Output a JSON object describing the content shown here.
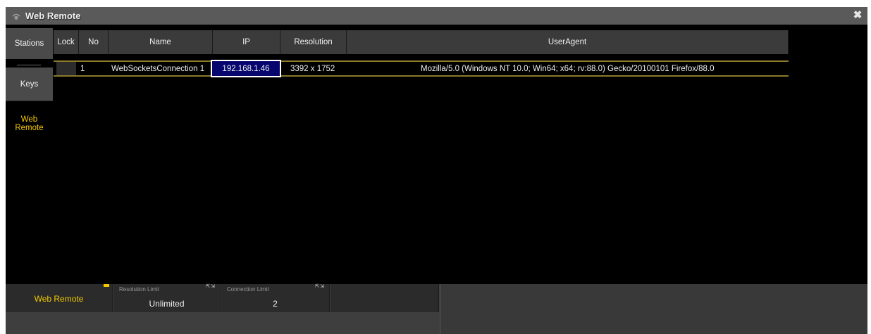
{
  "window": {
    "title": "Web Remote"
  },
  "sidebar": {
    "tabs": [
      {
        "label": "Stations"
      },
      {
        "label": "Keys"
      },
      {
        "label": "Web Remote"
      }
    ]
  },
  "table": {
    "headers": {
      "lock": "Lock",
      "no": "No",
      "name": "Name",
      "ip": "IP",
      "resolution": "Resolution",
      "useragent": "UserAgent"
    },
    "rows": [
      {
        "lock": "",
        "no": "1",
        "name": "WebSocketsConnection 1",
        "ip": "192.168.1.46",
        "resolution": "3392 x 1752",
        "useragent": "Mozilla/5.0 (Windows NT 10.0; Win64; x64; rv:88.0) Gecko/20100101 Firefox/88.0"
      }
    ]
  },
  "bottom": {
    "title": "Web Remote",
    "resolution_limit": {
      "label": "Resolution Limit",
      "value": "Unlimited"
    },
    "connection_limit": {
      "label": "Connection Limit",
      "value": "2"
    }
  },
  "colors": {
    "accent": "#f2c800",
    "selection": "#06066e",
    "background": "#000000"
  },
  "icons": [
    "web-remote-icon",
    "close-icon"
  ]
}
